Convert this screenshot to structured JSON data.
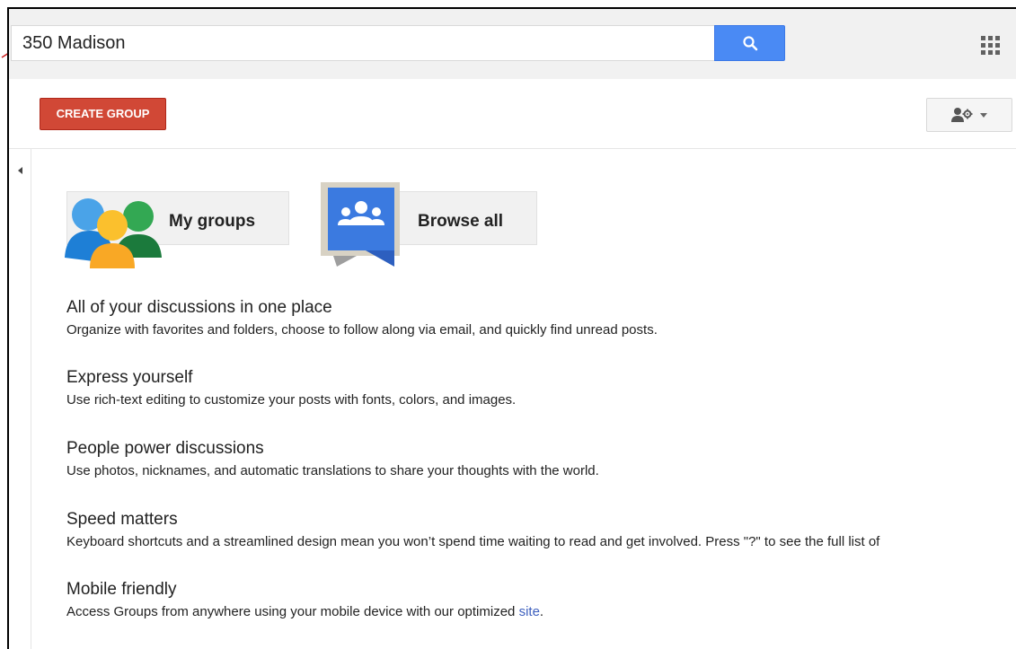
{
  "search": {
    "value": "350 Madison"
  },
  "icons": {
    "search": "search-icon",
    "apps": "apps-grid-icon",
    "settings": "people-settings-icon",
    "dropdown": "caret-down-icon",
    "collapse": "caret-left-icon",
    "my_groups": "my-groups-people-icon",
    "browse_all": "browse-all-groups-icon",
    "annotation": "red-arrow-annotation"
  },
  "colors": {
    "search_button": "#4a8af4",
    "create_button": "#d14836",
    "link": "#3d5fbe",
    "annotation_arrow": "#cc1f1f"
  },
  "toolbar": {
    "create_label": "CREATE GROUP"
  },
  "tiles": {
    "my_groups": "My groups",
    "browse_all": "Browse all"
  },
  "features": [
    {
      "title": "All of your discussions in one place",
      "desc": "Organize with favorites and folders, choose to follow along via email, and quickly find unread posts."
    },
    {
      "title": "Express yourself",
      "desc": "Use rich-text editing to customize your posts with fonts, colors, and images."
    },
    {
      "title": "People power discussions",
      "desc": "Use photos, nicknames, and automatic translations to share your thoughts with the world."
    },
    {
      "title": "Speed matters",
      "desc": "Keyboard shortcuts and a streamlined design mean you won’t spend time waiting to read and get involved. Press \"?\" to see the full list of"
    },
    {
      "title": "Mobile friendly",
      "desc": "Access Groups from anywhere using your mobile device with our optimized",
      "link": "site",
      "after_link": "."
    }
  ]
}
